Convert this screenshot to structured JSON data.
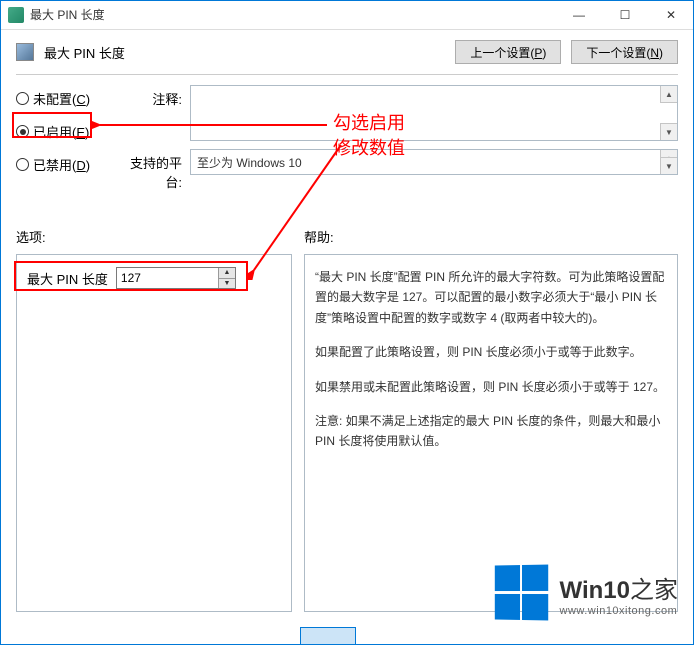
{
  "window": {
    "title": "最大 PIN 长度",
    "minimize": "—",
    "maximize": "☐",
    "close": "✕"
  },
  "header": {
    "title": "最大 PIN 长度",
    "prev_btn": "上一个设置(P)",
    "next_btn": "下一个设置(N)"
  },
  "radios": {
    "not_configured": "未配置(",
    "not_configured_u": "C",
    "not_configured_end": ")",
    "enabled": "已启用(",
    "enabled_u": "E",
    "enabled_end": ")",
    "disabled": "已禁用(",
    "disabled_u": "D",
    "disabled_end": ")",
    "selected": "enabled"
  },
  "fields": {
    "comment_label": "注释:",
    "comment_value": "",
    "platform_label": "支持的平台:",
    "platform_value": "至少为 Windows 10"
  },
  "sections": {
    "options_label": "选项:",
    "help_label": "帮助:"
  },
  "options": {
    "max_pin_label": "最大 PIN 长度",
    "max_pin_value": "127"
  },
  "help": {
    "p1": "“最大 PIN 长度”配置 PIN 所允许的最大字符数。可为此策略设置配置的最大数字是 127。可以配置的最小数字必须大于“最小 PIN 长度”策略设置中配置的数字或数字 4 (取两者中较大的)。",
    "p2": "如果配置了此策略设置，则 PIN 长度必须小于或等于此数字。",
    "p3": "如果禁用或未配置此策略设置，则 PIN 长度必须小于或等于 127。",
    "p4": "注意: 如果不满足上述指定的最大 PIN 长度的条件，则最大和最小 PIN 长度将使用默认值。"
  },
  "annotations": {
    "line1": "勾选启用",
    "line2": "修改数值"
  },
  "watermark": {
    "brand_main1": "Win10",
    "brand_main2": "之家",
    "url": "www.win10xitong.com"
  }
}
